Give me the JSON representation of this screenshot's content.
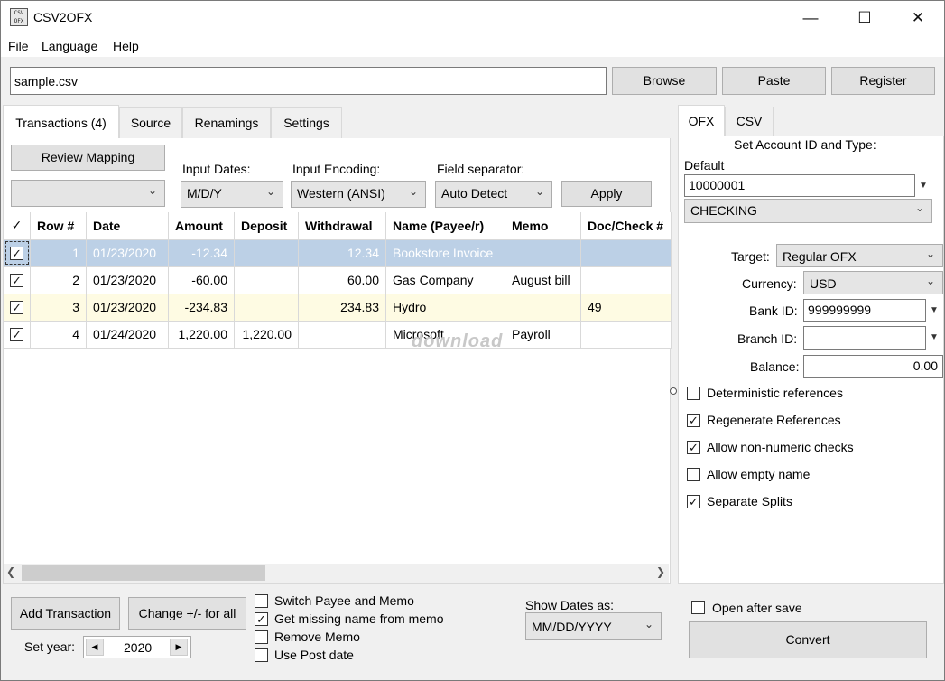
{
  "window": {
    "title": "CSV2OFX",
    "icon_text": "CSV OFX"
  },
  "menu": [
    "File",
    "Language",
    "Help"
  ],
  "file": {
    "path": "sample.csv"
  },
  "top_buttons": {
    "browse": "Browse",
    "paste": "Paste",
    "register": "Register"
  },
  "left_tabs": [
    "Transactions (4)",
    "Source",
    "Renamings",
    "Settings"
  ],
  "toolbar": {
    "review_mapping": "Review Mapping",
    "mapping_value": "",
    "input_dates_label": "Input Dates:",
    "input_dates_value": "M/D/Y",
    "encoding_label": "Input Encoding:",
    "encoding_value": "Western (ANSI)",
    "separator_label": "Field separator:",
    "separator_value": "Auto Detect",
    "apply": "Apply"
  },
  "table": {
    "columns": [
      "✓",
      "Row #",
      "Date",
      "Amount",
      "Deposit",
      "Withdrawal",
      "Name (Payee/r)",
      "Memo",
      "Doc/Check #"
    ],
    "rows": [
      {
        "checked": true,
        "row": "1",
        "date": "01/23/2020",
        "amount": "-12.34",
        "deposit": "",
        "withdrawal": "12.34",
        "name": "Bookstore Invoice",
        "memo": "",
        "doc": ""
      },
      {
        "checked": true,
        "row": "2",
        "date": "01/23/2020",
        "amount": "-60.00",
        "deposit": "",
        "withdrawal": "60.00",
        "name": "Gas Company",
        "memo": "August bill",
        "doc": ""
      },
      {
        "checked": true,
        "row": "3",
        "date": "01/23/2020",
        "amount": "-234.83",
        "deposit": "",
        "withdrawal": "234.83",
        "name": "Hydro",
        "memo": "",
        "doc": "49"
      },
      {
        "checked": true,
        "row": "4",
        "date": "01/24/2020",
        "amount": "1,220.00",
        "deposit": "1,220.00",
        "withdrawal": "",
        "name": "Microsoft",
        "memo": "Payroll",
        "doc": ""
      }
    ]
  },
  "watermark": "download",
  "bottom": {
    "add_transaction": "Add Transaction",
    "change_sign": "Change +/- for all",
    "set_year_label": "Set year:",
    "year": "2020",
    "options": [
      {
        "label": "Switch Payee and Memo",
        "checked": false
      },
      {
        "label": "Get missing name from memo",
        "checked": true
      },
      {
        "label": "Remove Memo",
        "checked": false
      },
      {
        "label": "Use Post date",
        "checked": false
      }
    ],
    "show_dates_label": "Show Dates as:",
    "show_dates_value": "MM/DD/YYYY"
  },
  "right_tabs": [
    "OFX",
    "CSV"
  ],
  "ofx": {
    "heading": "Set Account ID and Type:",
    "default_label": "Default",
    "account_id": "10000001",
    "account_type": "CHECKING",
    "target_label": "Target:",
    "target_value": "Regular OFX",
    "currency_label": "Currency:",
    "currency_value": "USD",
    "bank_label": "Bank ID:",
    "bank_value": "999999999",
    "branch_label": "Branch ID:",
    "branch_value": "",
    "balance_label": "Balance:",
    "balance_value": "0.00",
    "options": [
      {
        "label": "Deterministic references",
        "checked": false
      },
      {
        "label": "Regenerate References",
        "checked": true
      },
      {
        "label": "Allow non-numeric checks",
        "checked": true
      },
      {
        "label": "Allow empty name",
        "checked": false
      },
      {
        "label": "Separate Splits",
        "checked": true
      }
    ],
    "open_after_save": "Open after save",
    "open_after_save_checked": false,
    "convert": "Convert"
  }
}
